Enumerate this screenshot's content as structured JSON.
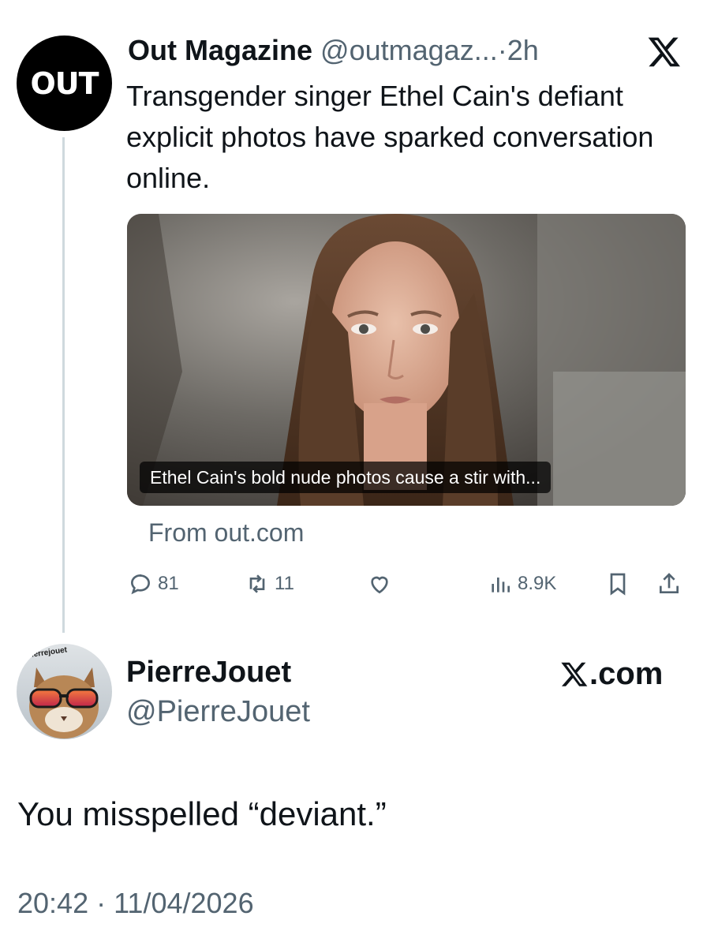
{
  "quoted_tweet": {
    "avatar_text": "OUT",
    "author_name": "Out Magazine",
    "author_handle": "@outmagaz...",
    "separator": "·",
    "time_ago": "2h",
    "text": "Transgender singer Ethel Cain's defiant explicit photos have sparked conversation online.",
    "card": {
      "caption": "Ethel Cain's bold nude photos cause a stir with...",
      "source": "From out.com"
    },
    "actions": {
      "replies": "81",
      "reposts": "11",
      "views": "8.9K"
    }
  },
  "reply": {
    "avatar_text": "Pierrejouet",
    "author_name": "PierreJouet",
    "author_handle": "@PierreJouet",
    "brand": ".com",
    "text": "You misspelled “deviant.”",
    "timestamp": "20:42 · 11/04/2026"
  }
}
